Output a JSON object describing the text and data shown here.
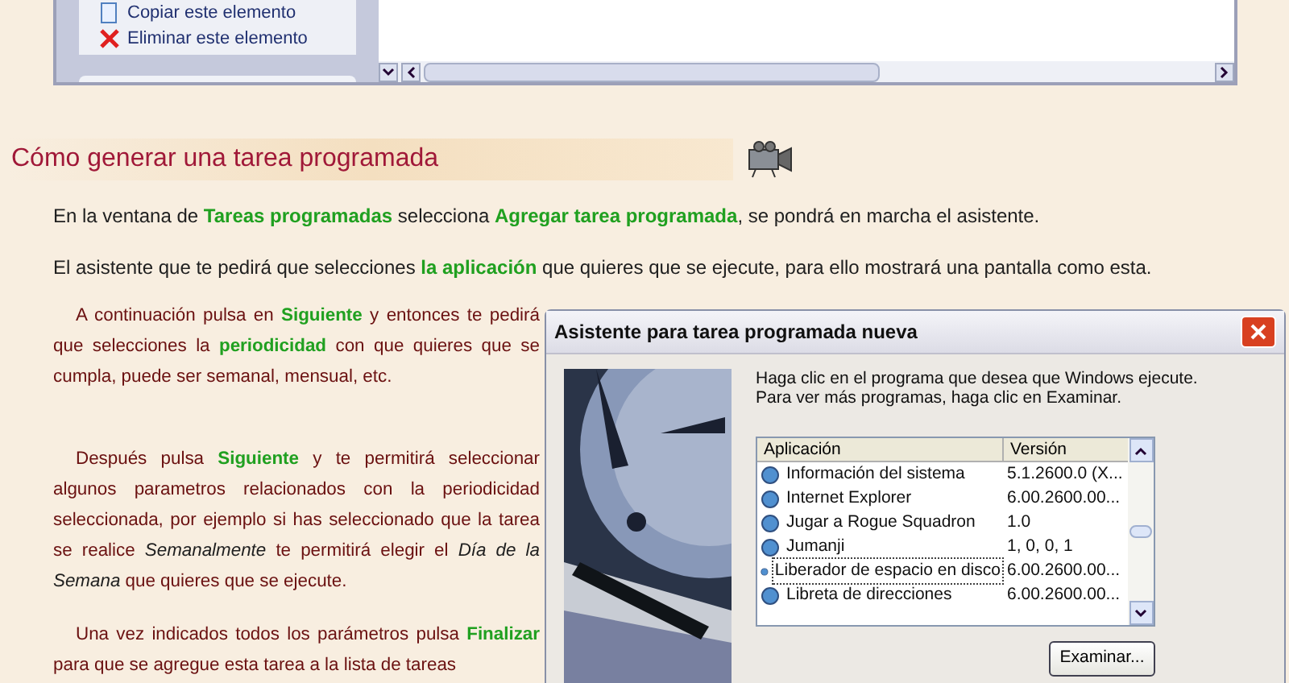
{
  "top_window": {
    "actions": [
      {
        "kind": "copy",
        "label": "Copiar este elemento"
      },
      {
        "kind": "delete",
        "label": "Eliminar este elemento"
      }
    ]
  },
  "heading": "Cómo generar una tarea programada",
  "paragraphs": [
    "En la ventana de **Tareas programadas** selecciona **Agregar tarea programada**, se pondrá en marcha el asistente.",
    "El asistente que te pedirá que selecciones **la aplicación** que quieres que se ejecute, para ello mostrará una pantalla como esta."
  ],
  "column_paragraphs": [
    "A continuación pulsa en **Siguiente** y entonces te pedirá que selecciones la **periodicidad** con que quieres que se cumpla, puede ser semanal, mensual, etc.",
    "Después pulsa **Siguiente** y te permitirá seleccionar algunos parametros relacionados con la periodicidad seleccionada, por ejemplo si has seleccionado que la tarea se realice *Semanalmente* te permitirá elegir el *Día de la Semana* que quieres que se ejecute.",
    "Una vez indicados todos los parámetros pulsa **Finalizar** para que se agregue esta tarea a la lista de tareas"
  ],
  "dialog": {
    "title": "Asistente para tarea programada nueva",
    "instructions": [
      "Haga clic en el programa que desea que Windows ejecute.",
      "Para ver más programas, haga clic en Examinar."
    ],
    "columns": [
      "Aplicación",
      "Versión"
    ],
    "rows": [
      {
        "name": "Información del sistema",
        "version": "5.1.2600.0 (X...",
        "selected": false
      },
      {
        "name": "Internet Explorer",
        "version": "6.00.2600.00...",
        "selected": false
      },
      {
        "name": "Jugar a Rogue Squadron",
        "version": "1.0",
        "selected": false
      },
      {
        "name": "Jumanji",
        "version": "1, 0, 0, 1",
        "selected": false
      },
      {
        "name": "Liberador de espacio en disco",
        "version": "6.00.2600.00...",
        "selected": true
      },
      {
        "name": "Libreta de direcciones",
        "version": "6.00.2600.00...",
        "selected": false
      }
    ],
    "browse_button": "Examinar..."
  }
}
